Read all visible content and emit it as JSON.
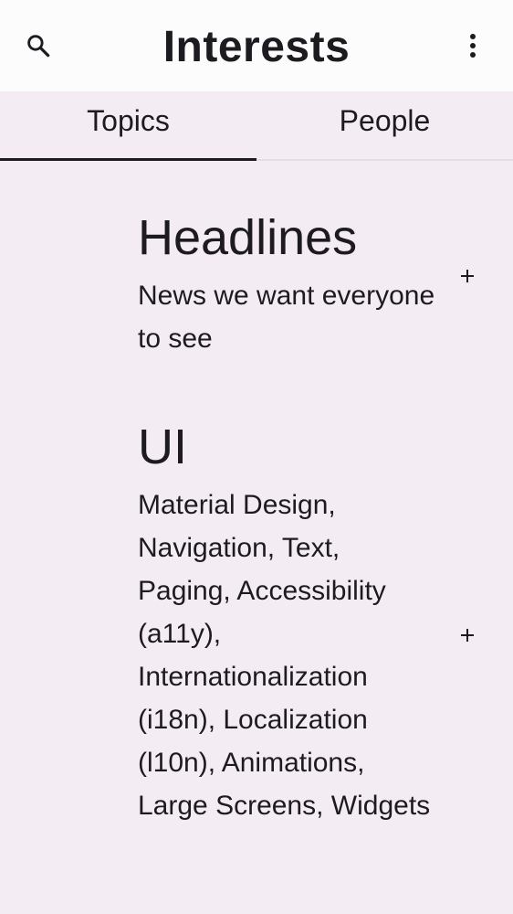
{
  "top_bar": {
    "title": "Interests",
    "search_icon": "search-icon",
    "more_icon": "more-vertical-icon"
  },
  "tabs": [
    {
      "label": "Topics",
      "selected": true
    },
    {
      "label": "People",
      "selected": false
    }
  ],
  "topics": [
    {
      "name": "Headlines",
      "description": "News we want everyone to see",
      "follow_icon": "plus-icon"
    },
    {
      "name": "UI",
      "description": "Material Design, Navigation, Text, Paging, Accessibility (a11y), Internationalization (i18n), Localization (l10n), Animations, Large Screens, Widgets",
      "follow_icon": "plus-icon"
    }
  ],
  "colors": {
    "background": "#f3edf3",
    "top_bar": "#fdfcfd",
    "text": "#1d1b20",
    "tab_divider": "#e7dbe6"
  }
}
